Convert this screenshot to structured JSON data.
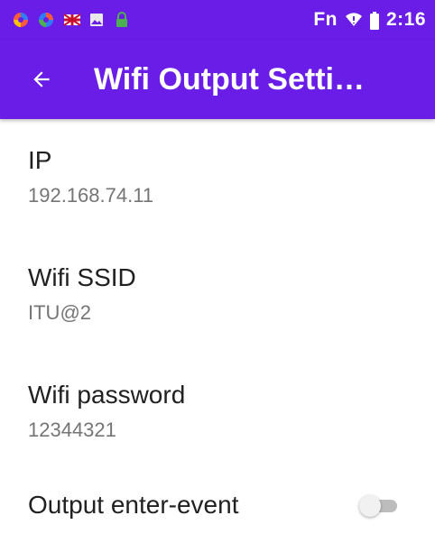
{
  "status_bar": {
    "carrier_text": "Fn",
    "time": "2:16",
    "icons": [
      "colorful-circle-icon",
      "colorful-circle-icon",
      "flag-icon",
      "image-icon",
      "lock-icon",
      "wifi-signal-icon",
      "battery-icon"
    ]
  },
  "app_bar": {
    "title": "Wifi Output Setti…",
    "back_icon": "arrow-left-icon"
  },
  "settings": {
    "ip": {
      "title": "IP",
      "summary": "192.168.74.11"
    },
    "ssid": {
      "title": "Wifi SSID",
      "summary": "ITU@2"
    },
    "password": {
      "title": "Wifi password",
      "summary": "12344321"
    },
    "enter_event": {
      "title": "Output enter-event",
      "enabled": false
    }
  },
  "colors": {
    "accent": "#6a1de6",
    "title_text": "#212121",
    "summary_text": "#757575"
  }
}
